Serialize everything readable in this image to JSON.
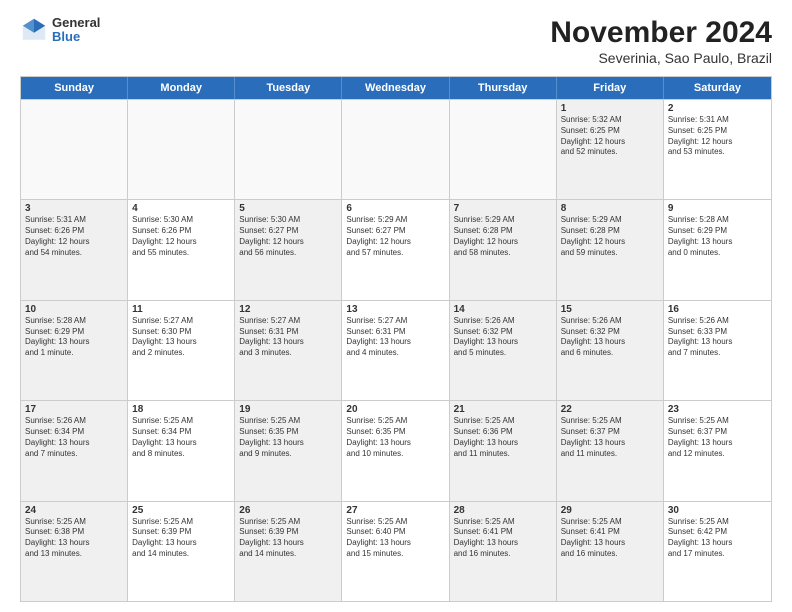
{
  "header": {
    "logo": {
      "general": "General",
      "blue": "Blue"
    },
    "title": "November 2024",
    "subtitle": "Severinia, Sao Paulo, Brazil"
  },
  "calendar": {
    "days": [
      "Sunday",
      "Monday",
      "Tuesday",
      "Wednesday",
      "Thursday",
      "Friday",
      "Saturday"
    ],
    "rows": [
      [
        {
          "day": "",
          "content": "",
          "empty": true
        },
        {
          "day": "",
          "content": "",
          "empty": true
        },
        {
          "day": "",
          "content": "",
          "empty": true
        },
        {
          "day": "",
          "content": "",
          "empty": true
        },
        {
          "day": "",
          "content": "",
          "empty": true
        },
        {
          "day": "1",
          "content": "Sunrise: 5:32 AM\nSunset: 6:25 PM\nDaylight: 12 hours\nand 52 minutes.",
          "shaded": true
        },
        {
          "day": "2",
          "content": "Sunrise: 5:31 AM\nSunset: 6:25 PM\nDaylight: 12 hours\nand 53 minutes.",
          "shaded": false
        }
      ],
      [
        {
          "day": "3",
          "content": "Sunrise: 5:31 AM\nSunset: 6:26 PM\nDaylight: 12 hours\nand 54 minutes.",
          "shaded": true
        },
        {
          "day": "4",
          "content": "Sunrise: 5:30 AM\nSunset: 6:26 PM\nDaylight: 12 hours\nand 55 minutes.",
          "shaded": false
        },
        {
          "day": "5",
          "content": "Sunrise: 5:30 AM\nSunset: 6:27 PM\nDaylight: 12 hours\nand 56 minutes.",
          "shaded": true
        },
        {
          "day": "6",
          "content": "Sunrise: 5:29 AM\nSunset: 6:27 PM\nDaylight: 12 hours\nand 57 minutes.",
          "shaded": false
        },
        {
          "day": "7",
          "content": "Sunrise: 5:29 AM\nSunset: 6:28 PM\nDaylight: 12 hours\nand 58 minutes.",
          "shaded": true
        },
        {
          "day": "8",
          "content": "Sunrise: 5:29 AM\nSunset: 6:28 PM\nDaylight: 12 hours\nand 59 minutes.",
          "shaded": true
        },
        {
          "day": "9",
          "content": "Sunrise: 5:28 AM\nSunset: 6:29 PM\nDaylight: 13 hours\nand 0 minutes.",
          "shaded": false
        }
      ],
      [
        {
          "day": "10",
          "content": "Sunrise: 5:28 AM\nSunset: 6:29 PM\nDaylight: 13 hours\nand 1 minute.",
          "shaded": true
        },
        {
          "day": "11",
          "content": "Sunrise: 5:27 AM\nSunset: 6:30 PM\nDaylight: 13 hours\nand 2 minutes.",
          "shaded": false
        },
        {
          "day": "12",
          "content": "Sunrise: 5:27 AM\nSunset: 6:31 PM\nDaylight: 13 hours\nand 3 minutes.",
          "shaded": true
        },
        {
          "day": "13",
          "content": "Sunrise: 5:27 AM\nSunset: 6:31 PM\nDaylight: 13 hours\nand 4 minutes.",
          "shaded": false
        },
        {
          "day": "14",
          "content": "Sunrise: 5:26 AM\nSunset: 6:32 PM\nDaylight: 13 hours\nand 5 minutes.",
          "shaded": true
        },
        {
          "day": "15",
          "content": "Sunrise: 5:26 AM\nSunset: 6:32 PM\nDaylight: 13 hours\nand 6 minutes.",
          "shaded": true
        },
        {
          "day": "16",
          "content": "Sunrise: 5:26 AM\nSunset: 6:33 PM\nDaylight: 13 hours\nand 7 minutes.",
          "shaded": false
        }
      ],
      [
        {
          "day": "17",
          "content": "Sunrise: 5:26 AM\nSunset: 6:34 PM\nDaylight: 13 hours\nand 7 minutes.",
          "shaded": true
        },
        {
          "day": "18",
          "content": "Sunrise: 5:25 AM\nSunset: 6:34 PM\nDaylight: 13 hours\nand 8 minutes.",
          "shaded": false
        },
        {
          "day": "19",
          "content": "Sunrise: 5:25 AM\nSunset: 6:35 PM\nDaylight: 13 hours\nand 9 minutes.",
          "shaded": true
        },
        {
          "day": "20",
          "content": "Sunrise: 5:25 AM\nSunset: 6:35 PM\nDaylight: 13 hours\nand 10 minutes.",
          "shaded": false
        },
        {
          "day": "21",
          "content": "Sunrise: 5:25 AM\nSunset: 6:36 PM\nDaylight: 13 hours\nand 11 minutes.",
          "shaded": true
        },
        {
          "day": "22",
          "content": "Sunrise: 5:25 AM\nSunset: 6:37 PM\nDaylight: 13 hours\nand 11 minutes.",
          "shaded": true
        },
        {
          "day": "23",
          "content": "Sunrise: 5:25 AM\nSunset: 6:37 PM\nDaylight: 13 hours\nand 12 minutes.",
          "shaded": false
        }
      ],
      [
        {
          "day": "24",
          "content": "Sunrise: 5:25 AM\nSunset: 6:38 PM\nDaylight: 13 hours\nand 13 minutes.",
          "shaded": true
        },
        {
          "day": "25",
          "content": "Sunrise: 5:25 AM\nSunset: 6:39 PM\nDaylight: 13 hours\nand 14 minutes.",
          "shaded": false
        },
        {
          "day": "26",
          "content": "Sunrise: 5:25 AM\nSunset: 6:39 PM\nDaylight: 13 hours\nand 14 minutes.",
          "shaded": true
        },
        {
          "day": "27",
          "content": "Sunrise: 5:25 AM\nSunset: 6:40 PM\nDaylight: 13 hours\nand 15 minutes.",
          "shaded": false
        },
        {
          "day": "28",
          "content": "Sunrise: 5:25 AM\nSunset: 6:41 PM\nDaylight: 13 hours\nand 16 minutes.",
          "shaded": true
        },
        {
          "day": "29",
          "content": "Sunrise: 5:25 AM\nSunset: 6:41 PM\nDaylight: 13 hours\nand 16 minutes.",
          "shaded": true
        },
        {
          "day": "30",
          "content": "Sunrise: 5:25 AM\nSunset: 6:42 PM\nDaylight: 13 hours\nand 17 minutes.",
          "shaded": false
        }
      ]
    ]
  }
}
